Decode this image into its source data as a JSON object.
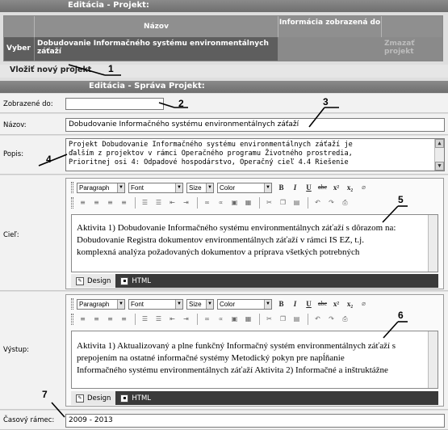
{
  "project_section": {
    "title": "Editácia - Projekt:",
    "columns": [
      "",
      "Názov",
      "Informácia zobrazená do",
      ""
    ],
    "row": {
      "select_label": "Vyber",
      "name": "Dobudovanie Informačného systému environmentálnych záťaží",
      "info": "",
      "delete_label": "Zmazať projekt"
    },
    "new_project_label": "Vložiť nový projekt"
  },
  "manage_section": {
    "title": "Editácia - Správa Projekt:",
    "fields": {
      "shown_to_label": "Zobrazené do:",
      "shown_to_value": "",
      "name_label": "Názov:",
      "name_value": "Dobudovanie Informačného systému environmentálnych záťaží",
      "description_label": "Popis:",
      "description_lines": [
        "Projekt Dobudovanie Informačného systému environmentálnych záťaží je",
        "ďalším z projektov v rámci Operačného programu Životného prostredia,",
        "Prioritnej osi 4: Odpadové hospodárstvo, Operačný cieľ 4.4 Riešenie"
      ],
      "goal_label": "Cieľ:",
      "goal_lines": [
        "Aktivita 1) Dobudovanie Informačného systému environmentálnych záťaží s dôrazom na:",
        "Dobudovanie Registra dokumentov environmentálnych záťaží v rámci IS EZ, t.j.",
        "komplexná analýza požadovaných dokumentov a príprava všetkých potrebných"
      ],
      "output_label": "Výstup:",
      "output_lines": [
        "Aktivita 1) Aktualizovaný a plne funkčný Informačný systém environmentálnych záťaží s",
        "prepojením na ostatné informačné systémy Metodický pokyn pre napĺňanie",
        "Informačného systému environmentálnych záťaží Aktivita 2) Informačné a inštruktážne"
      ],
      "timeframe_label": "Časový rámec:",
      "timeframe_value": "2009 - 2013"
    }
  },
  "editor_toolbar": {
    "paragraph": "Paragraph",
    "font": "Font",
    "size": "Size",
    "color": "Color",
    "bold": "B",
    "italic": "I",
    "underline": "U",
    "strike": "abc",
    "superscript": "x²",
    "subscript": "x₂"
  },
  "editor_tabs": {
    "design": "Design",
    "html": "HTML"
  },
  "callouts": [
    "1",
    "2",
    "3",
    "4",
    "5",
    "6",
    "7"
  ]
}
